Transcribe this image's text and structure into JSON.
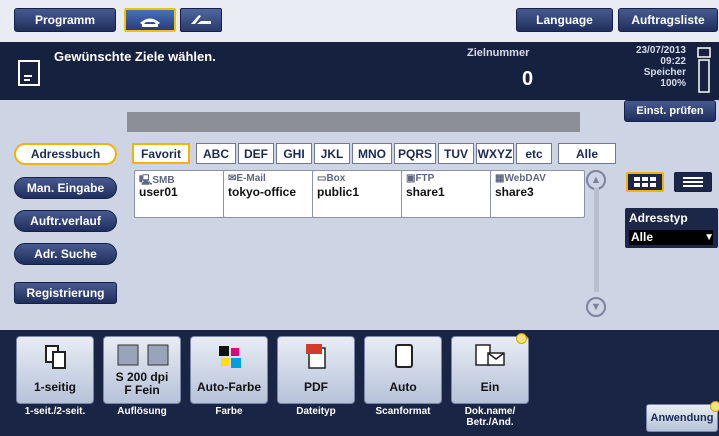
{
  "topbar": {
    "programm": "Programm",
    "language": "Language",
    "auftragsliste": "Auftragsliste"
  },
  "status": {
    "message": "Gewünschte Ziele wählen.",
    "zielnummer_label": "Zielnummer",
    "zielnummer_value": "0",
    "date": "23/07/2013",
    "time": "09:22",
    "speicher_label": "Speicher",
    "speicher_value": "100%",
    "einst_pruefen": "Einst. prüfen"
  },
  "nav": {
    "adressbuch": "Adressbuch",
    "man_eingabe": "Man. Eingabe",
    "auftr_verlauf": "Auftr.verlauf",
    "adr_suche": "Adr. Suche",
    "registrierung": "Registrierung"
  },
  "alpha_tabs": [
    "Favorit",
    "ABC",
    "DEF",
    "GHI",
    "JKL",
    "MNO",
    "PQRS",
    "TUV",
    "WXYZ",
    "etc",
    "Alle"
  ],
  "cards": [
    {
      "type": "SMB",
      "name": "user01",
      "icon": "pc-icon"
    },
    {
      "type": "E-Mail",
      "name": "tokyo-office",
      "icon": "envelope-icon"
    },
    {
      "type": "Box",
      "name": "public1",
      "icon": "box-icon"
    },
    {
      "type": "FTP",
      "name": "share1",
      "icon": "ftp-icon"
    },
    {
      "type": "WebDAV",
      "name": "share3",
      "icon": "webdav-icon"
    }
  ],
  "adresstyp": {
    "label": "Adresstyp",
    "value": "Alle"
  },
  "functions": [
    {
      "value": "1-seitig",
      "label": "1-seit./2-seit."
    },
    {
      "value": "S 200 dpi\nF Fein",
      "label": "Auflösung"
    },
    {
      "value": "Auto-Farbe",
      "label": "Farbe"
    },
    {
      "value": "PDF",
      "label": "Dateityp"
    },
    {
      "value": "Auto",
      "label": "Scanformat"
    },
    {
      "value": "Ein",
      "label": "Dok.name/\nBetr./And."
    }
  ],
  "anwendung": "Anwendung"
}
